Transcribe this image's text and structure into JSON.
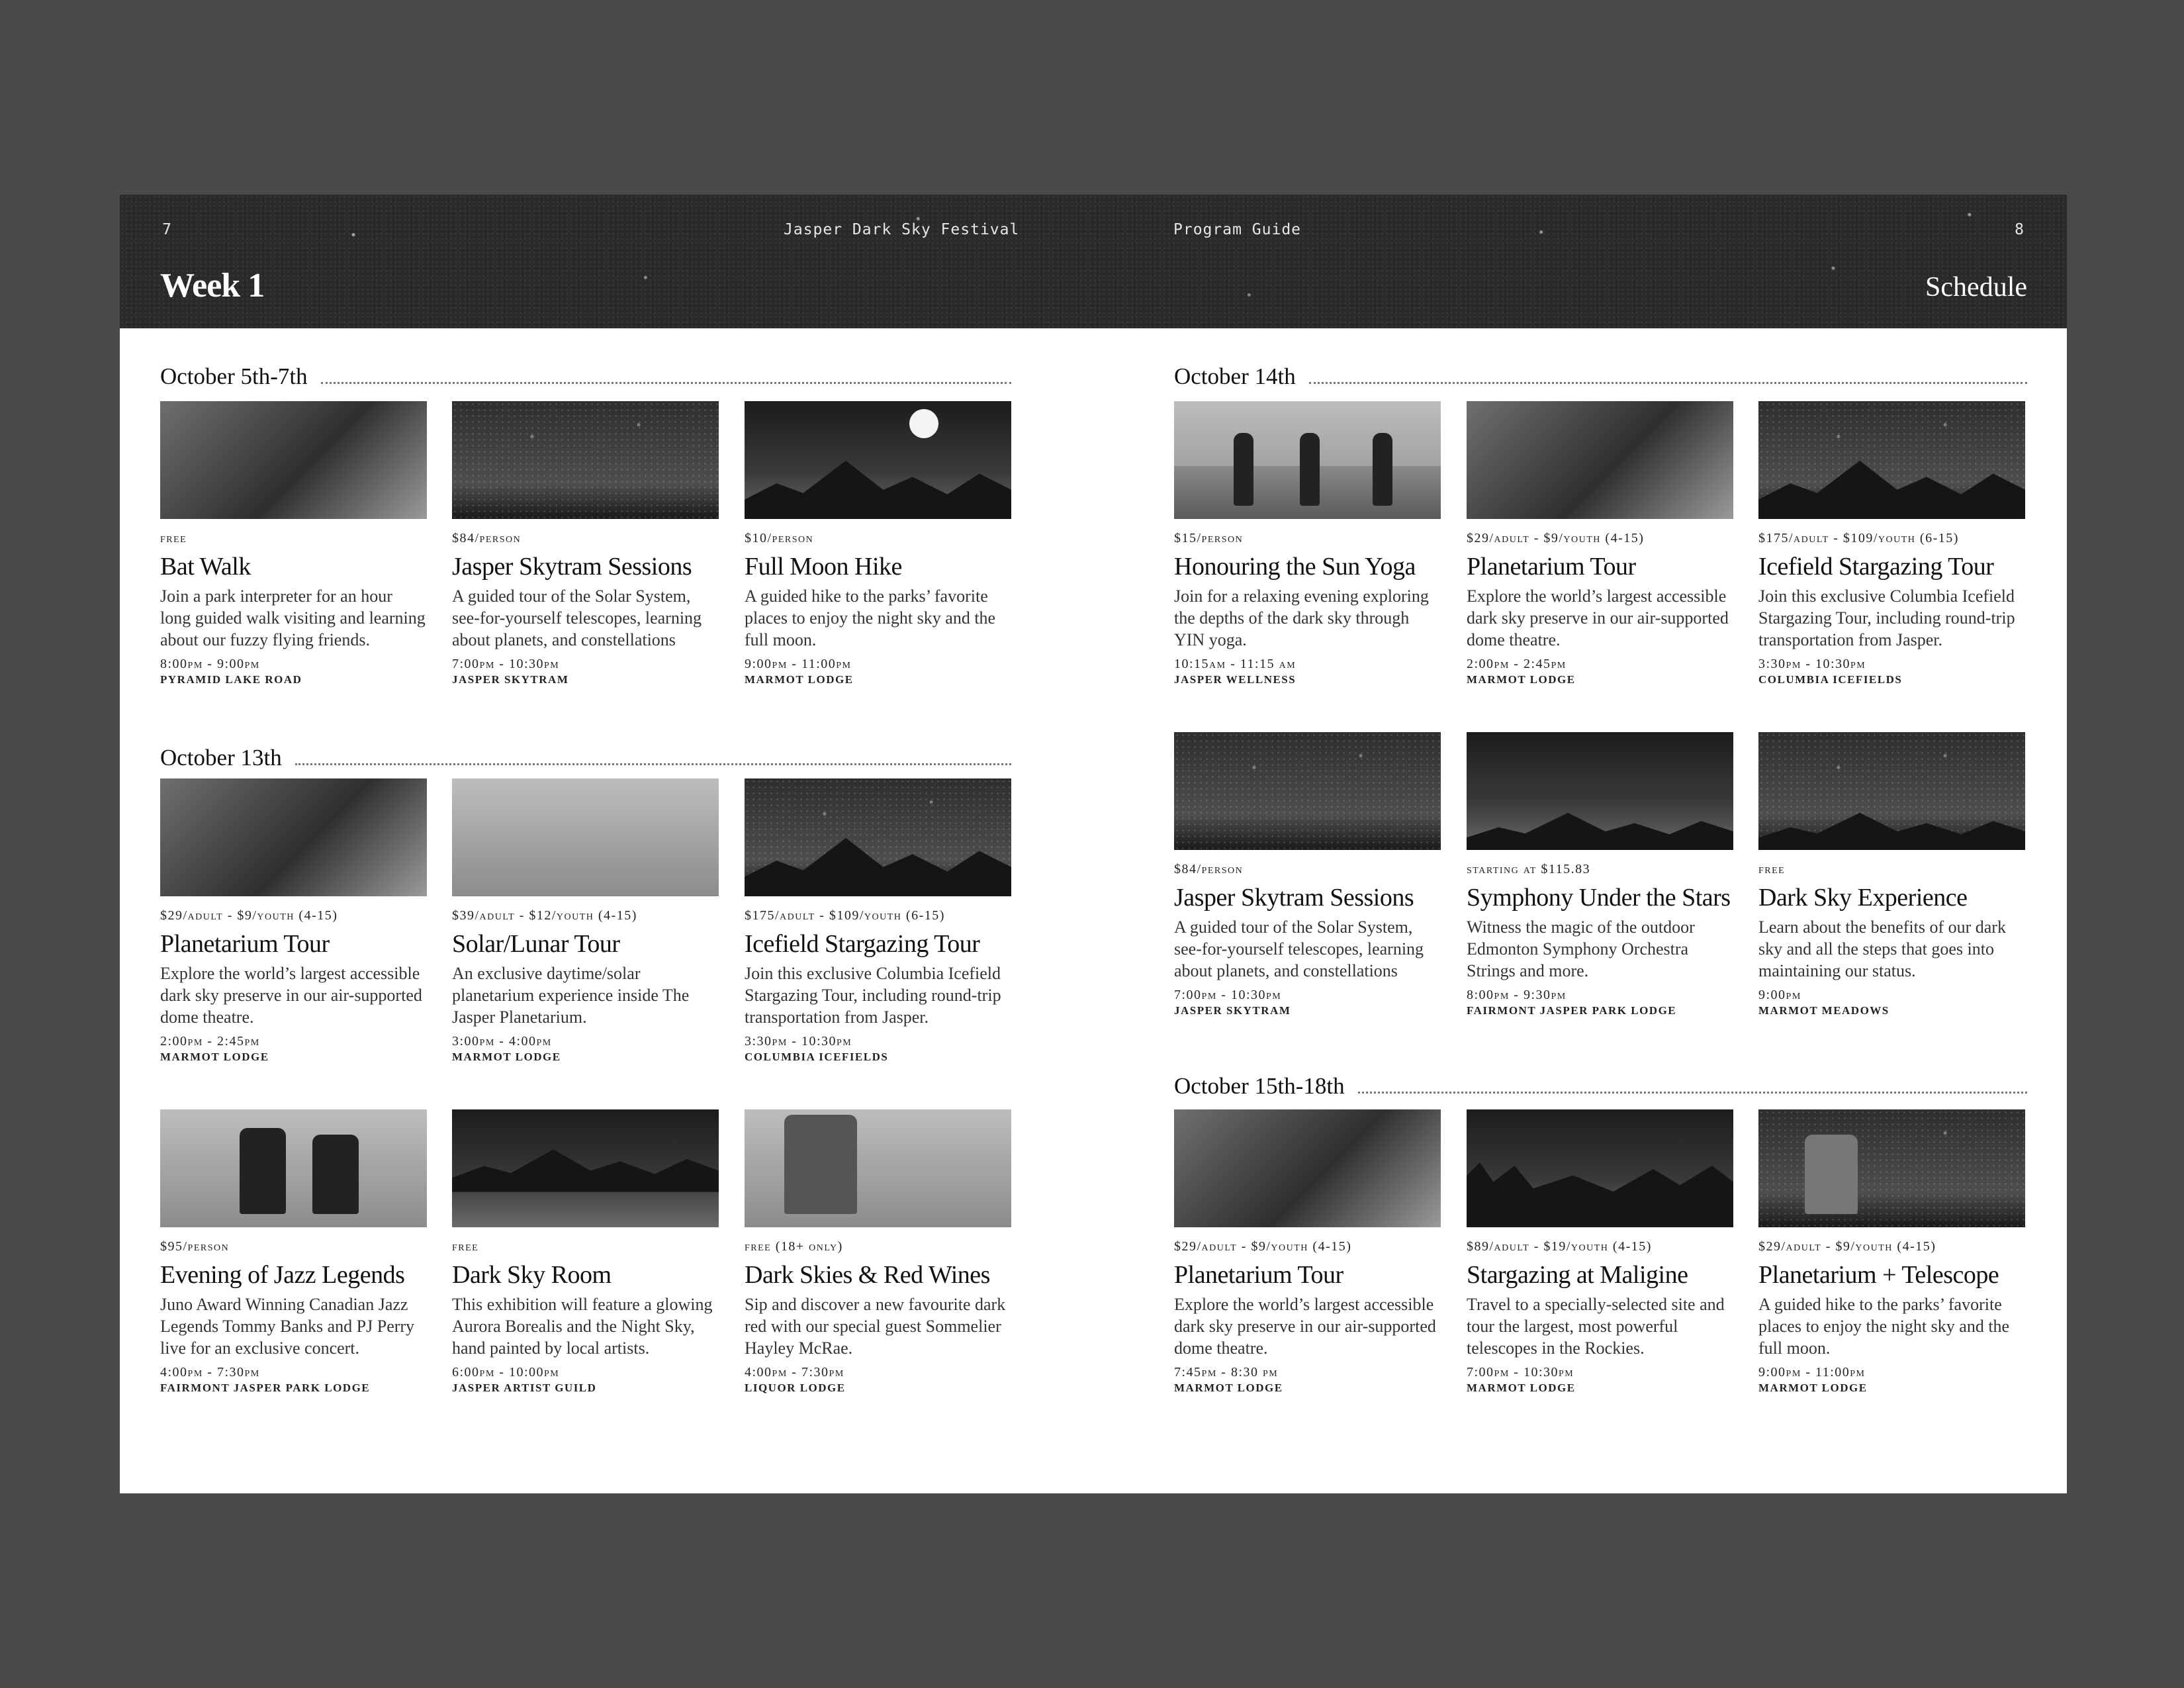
{
  "header": {
    "page_left": "7",
    "festival": "Jasper Dark Sky Festival",
    "guide": "Program Guide",
    "page_right": "8",
    "week": "Week 1",
    "schedule": "Schedule"
  },
  "sections": {
    "oct5": {
      "title": "October 5th-7th"
    },
    "oct13": {
      "title": "October 13th"
    },
    "oct14": {
      "title": "October 14th"
    },
    "oct15": {
      "title": "October 15th-18th"
    }
  },
  "events": {
    "e1": {
      "price": "free",
      "title": "Bat Walk",
      "desc": "Join a park interpreter for an hour long guided walk visiting and learning about our fuzzy flying friends.",
      "time": "8:00pm - 9:00pm",
      "location": "Pyramid Lake Road"
    },
    "e2": {
      "price": "$84/person",
      "title": "Jasper Skytram Sessions",
      "desc": "A guided tour of the Solar System, see-for-yourself telescopes, learning about planets, and constellations",
      "time": "7:00pm - 10:30pm",
      "location": "Jasper Skytram"
    },
    "e3": {
      "price": "$10/person",
      "title": "Full Moon Hike",
      "desc": "A guided hike to the parks’ favorite places to enjoy the night sky and the full moon.",
      "time": "9:00pm - 11:00pm",
      "location": "Marmot Lodge"
    },
    "e4": {
      "price": "$29/adult - $9/youth (4-15)",
      "title": "Planetarium Tour",
      "desc": "Explore the world’s largest accessible dark sky preserve in our air-supported dome theatre.",
      "time": "2:00pm - 2:45pm",
      "location": "Marmot Lodge"
    },
    "e5": {
      "price": "$39/adult - $12/youth (4-15)",
      "title": "Solar/Lunar Tour",
      "desc": "An exclusive daytime/solar planetarium experience inside The Jasper Planetarium.",
      "time": "3:00pm - 4:00pm",
      "location": "Marmot Lodge"
    },
    "e6": {
      "price": "$175/adult - $109/youth (6-15)",
      "title": "Icefield Stargazing Tour",
      "desc": "Join this exclusive Columbia Icefield Stargazing Tour, including round-trip transportation from Jasper.",
      "time": "3:30pm - 10:30pm",
      "location": "Columbia Icefields"
    },
    "e7": {
      "price": "$95/person",
      "title": "Evening of Jazz Legends",
      "desc": "Juno Award Winning Canadian Jazz Legends Tommy Banks and PJ Perry live for an exclusive concert.",
      "time": "4:00pm - 7:30pm",
      "location": "Fairmont Jasper Park Lodge"
    },
    "e8": {
      "price": "free",
      "title": "Dark Sky Room",
      "desc": "This exhibition will feature a glowing Aurora Borealis and the Night Sky, hand painted by local artists.",
      "time": "6:00pm - 10:00pm",
      "location": "Jasper Artist Guild"
    },
    "e9": {
      "price": "free (18+ only)",
      "title": "Dark Skies & Red Wines",
      "desc": "Sip and discover a new favourite dark red with our special guest Sommelier Hayley McRae.",
      "time": "4:00pm - 7:30pm",
      "location": "Liquor Lodge"
    },
    "e10": {
      "price": "$15/person",
      "title": "Honouring the Sun Yoga",
      "desc": "Join for a relaxing evening exploring the depths of the dark sky through YIN yoga.",
      "time": "10:15am - 11:15 am",
      "location": "Jasper Wellness"
    },
    "e11": {
      "price": "$29/adult - $9/youth (4-15)",
      "title": "Planetarium Tour",
      "desc": "Explore the world’s largest accessible dark sky preserve in our air-supported dome theatre.",
      "time": "2:00pm - 2:45pm",
      "location": "Marmot Lodge"
    },
    "e12": {
      "price": "$175/adult - $109/youth (6-15)",
      "title": "Icefield Stargazing Tour",
      "desc": "Join this exclusive Columbia Icefield Stargazing Tour, including round-trip transportation from Jasper.",
      "time": "3:30pm - 10:30pm",
      "location": "Columbia Icefields"
    },
    "e13": {
      "price": "$84/person",
      "title": "Jasper Skytram Sessions",
      "desc": "A guided tour of the Solar System, see-for-yourself telescopes, learning about planets, and constellations",
      "time": "7:00pm - 10:30pm",
      "location": "Jasper Skytram"
    },
    "e14": {
      "price": "starting at $115.83",
      "title": "Symphony Under the Stars",
      "desc": "Witness the magic of the outdoor Edmonton Symphony Orchestra Strings and more.",
      "time": "8:00pm - 9:30pm",
      "location": "Fairmont Jasper Park Lodge"
    },
    "e15": {
      "price": "free",
      "title": "Dark Sky Experience",
      "desc": "Learn about the benefits of our dark sky and all the steps that goes into maintaining our status.",
      "time": "9:00pm",
      "location": "Marmot Meadows"
    },
    "e16": {
      "price": "$29/adult - $9/youth (4-15)",
      "title": "Planetarium Tour",
      "desc": "Explore the world’s largest accessible dark sky preserve in our air-supported dome theatre.",
      "time": "7:45pm - 8:30 pm",
      "location": "Marmot Lodge"
    },
    "e17": {
      "price": "$89/adult - $19/youth (4-15)",
      "title": "Stargazing at Maligine",
      "desc": "Travel to a specially-selected site and tour the largest, most powerful telescopes in the Rockies.",
      "time": "7:00pm - 10:30pm",
      "location": "Marmot Lodge"
    },
    "e18": {
      "price": "$29/adult - $9/youth (4-15)",
      "title": "Planetarium + Telescope",
      "desc": "A guided hike to the parks’ favorite places to enjoy the night sky and the full moon.",
      "time": "9:00pm - 11:00pm",
      "location": "Marmot Lodge"
    }
  }
}
